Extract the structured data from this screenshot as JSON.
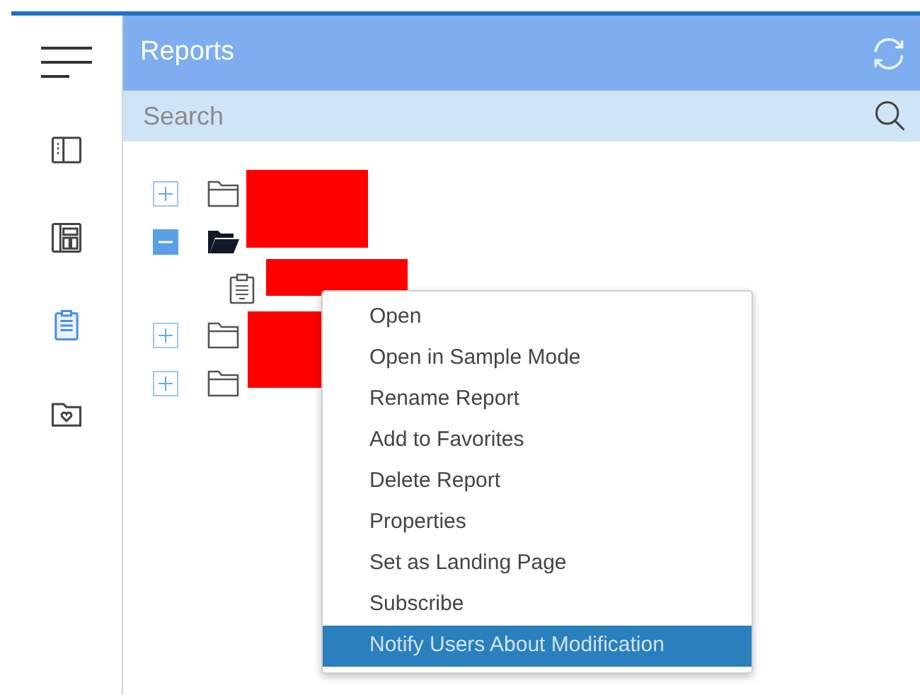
{
  "nav": [
    {
      "kind": "panel",
      "selected": false
    },
    {
      "kind": "dashboard",
      "selected": false
    },
    {
      "kind": "reports",
      "selected": true
    },
    {
      "kind": "favorites",
      "selected": false
    }
  ],
  "panel": {
    "title": "Reports",
    "search": {
      "placeholder": "Search"
    }
  },
  "tree": [
    {
      "kind": "folder",
      "expanded": false
    },
    {
      "kind": "folder",
      "expanded": true,
      "children": [
        {
          "kind": "report"
        }
      ]
    },
    {
      "kind": "folder",
      "expanded": false
    },
    {
      "kind": "folder",
      "expanded": false
    }
  ],
  "context_menu": [
    {
      "label": "Open",
      "selected": false
    },
    {
      "label": "Open in Sample Mode",
      "selected": false
    },
    {
      "label": "Rename Report",
      "selected": false
    },
    {
      "label": "Add to Favorites",
      "selected": false
    },
    {
      "label": "Delete Report",
      "selected": false
    },
    {
      "label": "Properties",
      "selected": false
    },
    {
      "label": "Set as Landing Page",
      "selected": false
    },
    {
      "label": "Subscribe",
      "selected": false
    },
    {
      "label": "Notify Users About Modification",
      "selected": true
    }
  ]
}
